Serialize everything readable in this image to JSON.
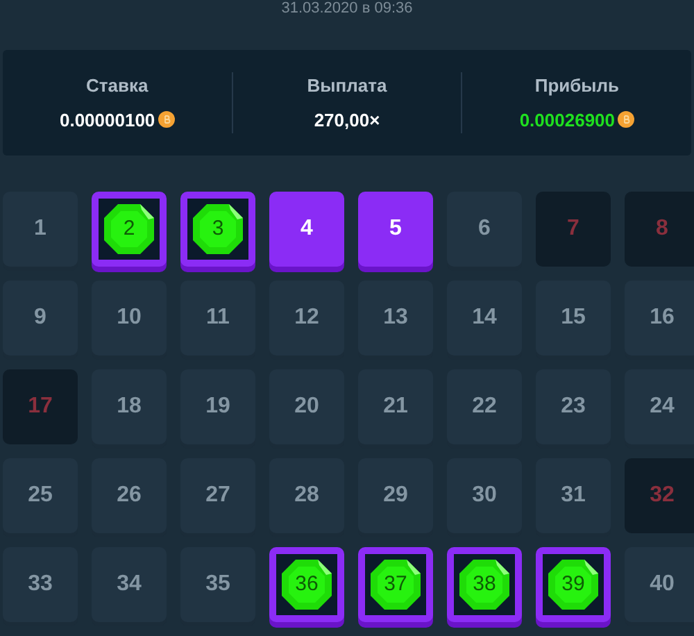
{
  "date": "31.03.2020 в 09:36",
  "stats": [
    {
      "label": "Ставка",
      "value": "0.00000100",
      "coin": true,
      "kind": "plain"
    },
    {
      "label": "Выплата",
      "value": "270,00×",
      "coin": false,
      "kind": "plain"
    },
    {
      "label": "Прибыль",
      "value": "0.00026900",
      "coin": true,
      "kind": "profit"
    }
  ],
  "tiles": [
    {
      "number": "1",
      "kind": "plain"
    },
    {
      "number": "2",
      "kind": "gem"
    },
    {
      "number": "3",
      "kind": "gem"
    },
    {
      "number": "4",
      "kind": "picked"
    },
    {
      "number": "5",
      "kind": "picked"
    },
    {
      "number": "6",
      "kind": "plain"
    },
    {
      "number": "7",
      "kind": "dark"
    },
    {
      "number": "8",
      "kind": "dark"
    },
    {
      "number": "9",
      "kind": "plain"
    },
    {
      "number": "10",
      "kind": "plain"
    },
    {
      "number": "11",
      "kind": "plain"
    },
    {
      "number": "12",
      "kind": "plain"
    },
    {
      "number": "13",
      "kind": "plain"
    },
    {
      "number": "14",
      "kind": "plain"
    },
    {
      "number": "15",
      "kind": "plain"
    },
    {
      "number": "16",
      "kind": "plain"
    },
    {
      "number": "17",
      "kind": "dark"
    },
    {
      "number": "18",
      "kind": "plain"
    },
    {
      "number": "19",
      "kind": "plain"
    },
    {
      "number": "20",
      "kind": "plain"
    },
    {
      "number": "21",
      "kind": "plain"
    },
    {
      "number": "22",
      "kind": "plain"
    },
    {
      "number": "23",
      "kind": "plain"
    },
    {
      "number": "24",
      "kind": "plain"
    },
    {
      "number": "25",
      "kind": "plain"
    },
    {
      "number": "26",
      "kind": "plain"
    },
    {
      "number": "27",
      "kind": "plain"
    },
    {
      "number": "28",
      "kind": "plain"
    },
    {
      "number": "29",
      "kind": "plain"
    },
    {
      "number": "30",
      "kind": "plain"
    },
    {
      "number": "31",
      "kind": "plain"
    },
    {
      "number": "32",
      "kind": "dark"
    },
    {
      "number": "33",
      "kind": "plain"
    },
    {
      "number": "34",
      "kind": "plain"
    },
    {
      "number": "35",
      "kind": "plain"
    },
    {
      "number": "36",
      "kind": "gem"
    },
    {
      "number": "37",
      "kind": "gem"
    },
    {
      "number": "38",
      "kind": "gem"
    },
    {
      "number": "39",
      "kind": "gem"
    },
    {
      "number": "40",
      "kind": "plain"
    }
  ]
}
